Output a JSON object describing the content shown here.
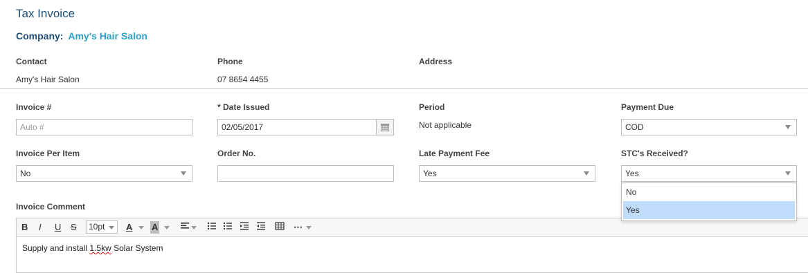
{
  "header": {
    "title": "Tax Invoice",
    "company_label": "Company:",
    "company_name": "Amy's Hair Salon"
  },
  "contact": {
    "label": "Contact",
    "value": "Amy's Hair Salon"
  },
  "phone": {
    "label": "Phone",
    "value": "07 8654 4455"
  },
  "address": {
    "label": "Address",
    "value": ""
  },
  "invoice_number": {
    "label": "Invoice #",
    "placeholder": "Auto #"
  },
  "date_issued": {
    "label": "* Date Issued",
    "value": "02/05/2017"
  },
  "period": {
    "label": "Period",
    "value": "Not applicable"
  },
  "payment_due": {
    "label": "Payment Due",
    "value": "COD"
  },
  "invoice_per_item": {
    "label": "Invoice Per Item",
    "value": "No"
  },
  "order_no": {
    "label": "Order No.",
    "value": ""
  },
  "late_payment_fee": {
    "label": "Late Payment Fee",
    "value": "Yes"
  },
  "stc_received": {
    "label": "STC's Received?",
    "value": "Yes",
    "options": [
      "No",
      "Yes"
    ],
    "highlighted": "Yes"
  },
  "invoice_comment": {
    "label": "Invoice Comment",
    "toolbar": {
      "font_size": "10pt",
      "bold": "B",
      "italic": "I",
      "underline": "U",
      "strike": "S",
      "font_color": "A",
      "highlight": "A",
      "more": "⋯"
    },
    "content_pre": "Supply and install ",
    "content_spell": "1.5kw",
    "content_post": " Solar System"
  },
  "colors": {
    "title": "#1f4e79",
    "company_name": "#2aa0c8",
    "dropdown_highlight": "#bfdcfa"
  },
  "icons": [
    "calendar-icon",
    "chevron-down-icon",
    "bold-icon",
    "italic-icon",
    "underline-icon",
    "strikethrough-icon",
    "font-color-icon",
    "highlight-color-icon",
    "align-left-icon",
    "bullet-list-icon",
    "numbered-list-icon",
    "indent-icon",
    "outdent-icon",
    "table-icon",
    "more-icon"
  ]
}
